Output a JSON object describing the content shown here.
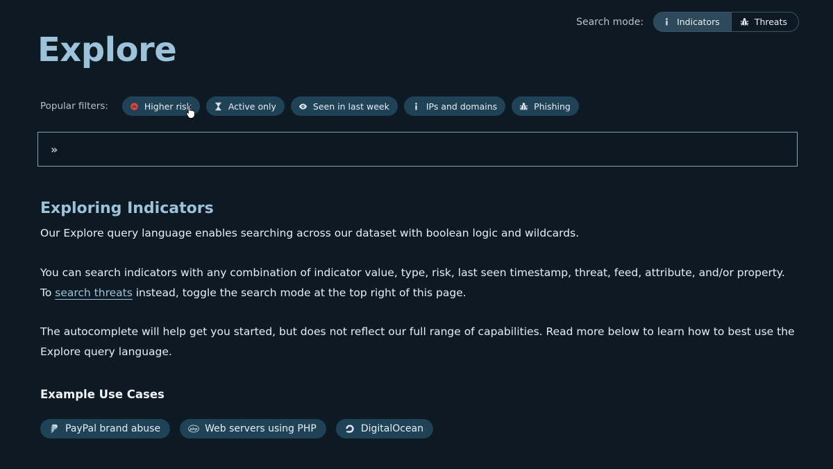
{
  "search_mode": {
    "label": "Search mode:",
    "options": [
      {
        "label": "Indicators",
        "icon": "info-icon",
        "active": true
      },
      {
        "label": "Threats",
        "icon": "bug-icon",
        "active": false
      }
    ]
  },
  "page_title": "Explore",
  "filters": {
    "label": "Popular filters:",
    "chips": [
      {
        "label": "Higher risk",
        "icon": "risk-icon"
      },
      {
        "label": "Active only",
        "icon": "hourglass-icon"
      },
      {
        "label": "Seen in last week",
        "icon": "eye-icon"
      },
      {
        "label": "IPs and domains",
        "icon": "info-icon"
      },
      {
        "label": "Phishing",
        "icon": "bug-icon"
      }
    ]
  },
  "query": {
    "prompt": "»",
    "value": "",
    "placeholder": ""
  },
  "content": {
    "heading": "Exploring Indicators",
    "p1": "Our Explore query language enables searching across our dataset with boolean logic and wildcards.",
    "p2_before": "You can search indicators with any combination of indicator value, type, risk, last seen timestamp, threat, feed, attribute, and/or property. To ",
    "p2_link": "search threats",
    "p2_after": " instead, toggle the search mode at the top right of this page.",
    "p3": "The autocomplete will help get you started, but does not reflect our full range of capabilities. Read more below to learn how to best use the Explore query language."
  },
  "use_cases": {
    "heading": "Example Use Cases",
    "items": [
      {
        "label": "PayPal brand abuse",
        "icon": "paypal-icon"
      },
      {
        "label": "Web servers using PHP",
        "icon": "php-icon"
      },
      {
        "label": "DigitalOcean",
        "icon": "digitalocean-icon"
      }
    ]
  },
  "colors": {
    "background": "#0d1a24",
    "accent": "#9dc3da",
    "chip_bg": "#1f4256",
    "risk": "#e0443e"
  }
}
